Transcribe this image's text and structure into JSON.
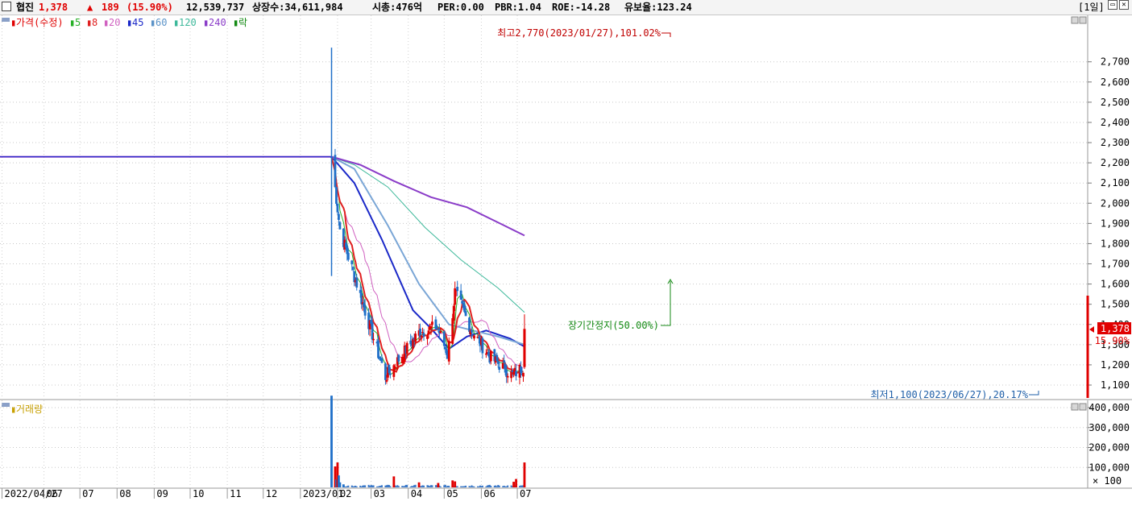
{
  "header": {
    "name": "협진",
    "price": "1,378",
    "change_symbol": "▲",
    "change": "189",
    "change_pct": "(15.90%)",
    "volume": "12,539,737",
    "listed_shares": "상장수:34,611,984",
    "market_cap": "시총:476억",
    "per": "PER:0.00",
    "pbr": "PBR:1.04",
    "roe": "ROE:-14.28",
    "float_ratio": "유보율:123.24",
    "period": "[1일]"
  },
  "colors": {
    "up": "#e00000",
    "down": "#1f6fc8",
    "ma5": "#27b027",
    "ma8": "#e02020",
    "ma20": "#d060c0",
    "ma45": "#1a28c8",
    "ma60": "#7aa6d6",
    "ma120": "#3cb89a",
    "ma240": "#8a3cc8"
  },
  "legend": {
    "price": "가격(수정)",
    "items": [
      {
        "label": "5",
        "color": "#27b027"
      },
      {
        "label": "8",
        "color": "#e02020"
      },
      {
        "label": "20",
        "color": "#d060c0"
      },
      {
        "label": "45",
        "color": "#1a28c8"
      },
      {
        "label": "60",
        "color": "#5b93c8"
      },
      {
        "label": "120",
        "color": "#3cb89a"
      },
      {
        "label": "240",
        "color": "#8a3cc8"
      },
      {
        "label": "락",
        "color": "#148a14"
      }
    ],
    "volume": "거래량"
  },
  "annotations": {
    "high": "최고2,770(2023/01/27),101.02%",
    "low": "최저1,100(2023/06/27),20.17%",
    "halt": "장기간정지(50.00%)"
  },
  "current": {
    "price": "1,378",
    "pct": "15.90%"
  },
  "volume_unit": "× 100",
  "chart_data": [
    {
      "type": "candlestick",
      "title": "",
      "y_ticks": [
        "1,100",
        "1,200",
        "1,300",
        "1,400",
        "1,500",
        "1,600",
        "1,700",
        "1,800",
        "1,900",
        "2,000",
        "2,100",
        "2,200",
        "2,300",
        "2,400",
        "2,500",
        "2,600",
        "2,700"
      ],
      "y_tick_values": [
        1100,
        1200,
        1300,
        1400,
        1500,
        1600,
        1700,
        1800,
        1900,
        2000,
        2100,
        2200,
        2300,
        2400,
        2500,
        2600,
        2700
      ],
      "ylim": [
        1050,
        2800
      ],
      "x_labels": [
        "2022/04/27",
        "06",
        "07",
        "08",
        "09",
        "10",
        "11",
        "12",
        "2023/01",
        "02",
        "03",
        "04",
        "05",
        "06",
        "07"
      ],
      "x_label_dates": [
        "2022-04-27",
        "2022-06-01",
        "2022-07-01",
        "2022-08-01",
        "2022-09-01",
        "2022-10-01",
        "2022-11-01",
        "2022-12-01",
        "2023-01-01",
        "2023-02-01",
        "2023-03-01",
        "2023-04-01",
        "2023-05-01",
        "2023-06-01",
        "2023-07-01"
      ],
      "pre_halt_level": 2230,
      "halt_end_date": "2023-01-27",
      "halt_end_candle": {
        "open": 1640,
        "high": 2770,
        "low": 1640,
        "close": 1640
      },
      "segments": [
        {
          "from": "2023-01-27",
          "to": "2023-02-03",
          "start": 2230,
          "end": 1870
        },
        {
          "from": "2023-02-03",
          "to": "2023-03-13",
          "start": 1870,
          "end": 1140
        },
        {
          "from": "2023-03-13",
          "to": "2023-04-10",
          "start": 1140,
          "end": 1360
        },
        {
          "from": "2023-04-10",
          "to": "2023-04-25",
          "start": 1360,
          "end": 1390
        },
        {
          "from": "2023-04-25",
          "to": "2023-05-04",
          "start": 1390,
          "end": 1250
        },
        {
          "from": "2023-05-04",
          "to": "2023-05-10",
          "start": 1250,
          "end": 1560
        },
        {
          "from": "2023-05-10",
          "to": "2023-05-24",
          "start": 1560,
          "end": 1370
        },
        {
          "from": "2023-05-24",
          "to": "2023-06-08",
          "start": 1370,
          "end": 1240
        },
        {
          "from": "2023-06-08",
          "to": "2023-06-27",
          "start": 1240,
          "end": 1150
        },
        {
          "from": "2023-06-27",
          "to": "2023-07-06",
          "start": 1150,
          "end": 1190
        }
      ],
      "last_candle": {
        "date": "2023-07-07",
        "open": 1189,
        "high": 1450,
        "low": 1180,
        "close": 1378
      },
      "moving_averages": [
        {
          "period": 45,
          "color": "#1a28c8",
          "points": [
            [
              "2023-01-27",
              2230
            ],
            [
              "2023-02-15",
              2100
            ],
            [
              "2023-03-10",
              1820
            ],
            [
              "2023-04-05",
              1470
            ],
            [
              "2023-04-20",
              1380
            ],
            [
              "2023-05-05",
              1280
            ],
            [
              "2023-05-20",
              1340
            ],
            [
              "2023-06-05",
              1370
            ],
            [
              "2023-06-25",
              1330
            ],
            [
              "2023-07-07",
              1290
            ]
          ]
        },
        {
          "period": 60,
          "color": "#7aa6d6",
          "points": [
            [
              "2023-01-27",
              2230
            ],
            [
              "2023-02-15",
              2170
            ],
            [
              "2023-03-15",
              1890
            ],
            [
              "2023-04-10",
              1600
            ],
            [
              "2023-05-05",
              1400
            ],
            [
              "2023-05-25",
              1370
            ],
            [
              "2023-06-15",
              1340
            ],
            [
              "2023-07-07",
              1300
            ]
          ]
        },
        {
          "period": 120,
          "color": "#3cb89a",
          "points": [
            [
              "2023-01-27",
              2230
            ],
            [
              "2023-02-15",
              2190
            ],
            [
              "2023-03-15",
              2080
            ],
            [
              "2023-04-15",
              1880
            ],
            [
              "2023-05-15",
              1720
            ],
            [
              "2023-06-15",
              1580
            ],
            [
              "2023-07-07",
              1460
            ]
          ]
        },
        {
          "period": 240,
          "color": "#8a3cc8",
          "points": [
            [
              "2023-01-27",
              2230
            ],
            [
              "2023-02-20",
              2190
            ],
            [
              "2023-03-20",
              2110
            ],
            [
              "2023-04-20",
              2030
            ],
            [
              "2023-05-20",
              1980
            ],
            [
              "2023-06-20",
              1890
            ],
            [
              "2023-07-07",
              1840
            ]
          ]
        }
      ]
    },
    {
      "type": "bar",
      "title": "",
      "y_ticks": [
        "100,000",
        "200,000",
        "300,000",
        "400,000"
      ],
      "y_tick_values": [
        100000,
        200000,
        300000,
        400000
      ],
      "ylim": [
        0,
        480000
      ],
      "bars": [
        {
          "date": "2023-01-27",
          "value": 460000,
          "dir": "down"
        },
        {
          "date": "2023-01-30",
          "value": 105000,
          "dir": "up"
        },
        {
          "date": "2023-01-31",
          "value": 40000,
          "dir": "down"
        },
        {
          "date": "2023-02-01",
          "value": 125000,
          "dir": "up"
        },
        {
          "date": "2023-02-02",
          "value": 60000,
          "dir": "down"
        },
        {
          "date": "2023-02-03",
          "value": 25000,
          "dir": "down"
        },
        {
          "date": "2023-02-06",
          "value": 15000,
          "dir": "down"
        },
        {
          "date": "2023-03-20",
          "value": 55000,
          "dir": "up"
        },
        {
          "date": "2023-04-10",
          "value": 25000,
          "dir": "up"
        },
        {
          "date": "2023-04-26",
          "value": 22000,
          "dir": "up"
        },
        {
          "date": "2023-05-08",
          "value": 35000,
          "dir": "up"
        },
        {
          "date": "2023-05-10",
          "value": 30000,
          "dir": "up"
        },
        {
          "date": "2023-06-28",
          "value": 28000,
          "dir": "up"
        },
        {
          "date": "2023-06-30",
          "value": 42000,
          "dir": "up"
        },
        {
          "date": "2023-07-07",
          "value": 125000,
          "dir": "up"
        }
      ]
    }
  ]
}
